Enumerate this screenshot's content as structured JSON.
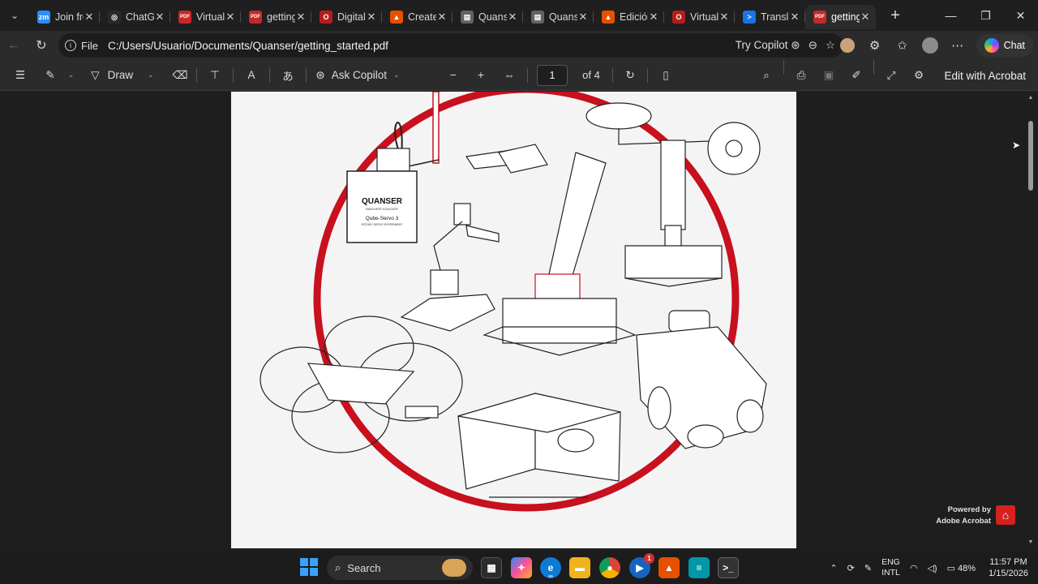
{
  "browser": {
    "tabs": [
      {
        "title": "Join fro",
        "icon": "zoom-icon",
        "color": "#2d8cff",
        "glyph": "zm"
      },
      {
        "title": "ChatGPT",
        "icon": "chatgpt-icon",
        "color": "#2a2a2a",
        "glyph": "◎"
      },
      {
        "title": "Virtual",
        "icon": "pdf-icon",
        "color": "#c62828",
        "glyph": "PDF"
      },
      {
        "title": "getting",
        "icon": "pdf-icon",
        "color": "#c62828",
        "glyph": "PDF"
      },
      {
        "title": "Digital",
        "icon": "opera-icon",
        "color": "#b71c1c",
        "glyph": "O"
      },
      {
        "title": "Create",
        "icon": "matlab-icon",
        "color": "#e65100",
        "glyph": "▲"
      },
      {
        "title": "Quanser",
        "icon": "doc-icon",
        "color": "#5f6368",
        "glyph": "▤"
      },
      {
        "title": "Quanser",
        "icon": "doc-icon",
        "color": "#5f6368",
        "glyph": "▤"
      },
      {
        "title": "Edición",
        "icon": "matlab-icon",
        "color": "#e65100",
        "glyph": "▲"
      },
      {
        "title": "Virtual",
        "icon": "opera-icon",
        "color": "#b71c1c",
        "glyph": "O"
      },
      {
        "title": "Transla",
        "icon": "terminal-icon",
        "color": "#1a73e8",
        "glyph": ">"
      },
      {
        "title": "getting",
        "icon": "pdf-icon",
        "color": "#c62828",
        "glyph": "PDF",
        "active": true
      }
    ],
    "address": {
      "scheme": "File",
      "url": "C:/Users/Usuario/Documents/Quanser/getting_started.pdf",
      "try_copilot": "Try Copilot"
    },
    "chat_label": "Chat"
  },
  "pdf_toolbar": {
    "draw_label": "Draw",
    "ask_copilot_label": "Ask Copilot",
    "page_current": "1",
    "page_total": "of 4",
    "edit_label": "Edit with Acrobat"
  },
  "pdf_page": {
    "box_brand": "QUANSER",
    "box_tagline": "INNOVATE  EDUCATE",
    "box_product": "Qube-Servo 3",
    "box_subtitle": "ROTARY SERVO EXPERIMENT",
    "accent_color": "#c8101e"
  },
  "viewer_footer": {
    "powered_by": "Powered by",
    "product": "Adobe Acrobat"
  },
  "taskbar": {
    "search_label": "Search",
    "lang_top": "ENG",
    "lang_bottom": "INTL",
    "battery": "48%",
    "time": "11:57 PM",
    "date": "1/15/2026",
    "notif_count": "1"
  }
}
